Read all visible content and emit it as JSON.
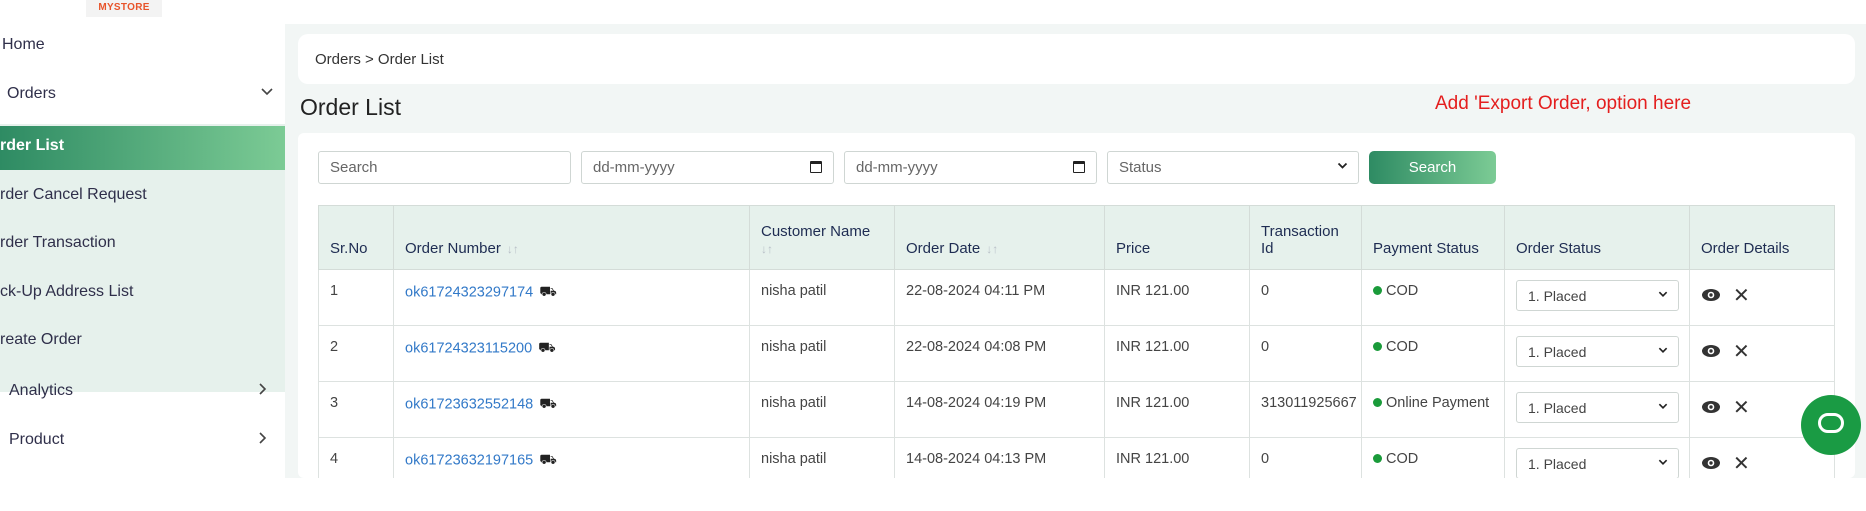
{
  "app": {
    "logo_text": "MYSTORE"
  },
  "sidebar": {
    "home": "Home",
    "orders": "Orders",
    "order_list": "rder List",
    "order_cancel_request": "rder Cancel Request",
    "order_transaction": "rder Transaction",
    "pickup_address_list": "ck-Up Address List",
    "create_order": "reate Order",
    "analytics": "Analytics",
    "product": "Product"
  },
  "breadcrumb": "Orders > Order List",
  "page_title": "Order List",
  "note": "Add 'Export Order, option here",
  "filters": {
    "search_placeholder": "Search",
    "date_from_placeholder": "dd-mm-yyyy",
    "date_to_placeholder": "dd-mm-yyyy",
    "status_selected": "Status",
    "search_button": "Search"
  },
  "table": {
    "headers": {
      "sr_no": "Sr.No",
      "order_number": "Order Number",
      "customer_name": "Customer Name",
      "order_date": "Order Date",
      "price": "Price",
      "transaction_id": "Transaction Id",
      "payment_status": "Payment Status",
      "order_status": "Order Status",
      "order_details": "Order Details"
    },
    "rows": [
      {
        "sr": "1",
        "order_number": "ok61724323297174",
        "customer": "nisha patil",
        "date": "22-08-2024 04:11 PM",
        "price": "INR 121.00",
        "txn": "0",
        "payment": "COD",
        "status": "1. Placed"
      },
      {
        "sr": "2",
        "order_number": "ok61724323115200",
        "customer": "nisha patil",
        "date": "22-08-2024 04:08 PM",
        "price": "INR 121.00",
        "txn": "0",
        "payment": "COD",
        "status": "1. Placed"
      },
      {
        "sr": "3",
        "order_number": "ok61723632552148",
        "customer": "nisha patil",
        "date": "14-08-2024 04:19 PM",
        "price": "INR 121.00",
        "txn": "313011925667",
        "payment": "Online Payment",
        "status": "1. Placed"
      },
      {
        "sr": "4",
        "order_number": "ok61723632197165",
        "customer": "nisha patil",
        "date": "14-08-2024 04:13 PM",
        "price": "INR 121.00",
        "txn": "0",
        "payment": "COD",
        "status": "1. Placed"
      }
    ]
  },
  "colors": {
    "accent": "#2e8b63",
    "accent_light": "#7ccb95",
    "note": "#e41e1e",
    "link": "#3279c8",
    "status_dot": "#1a9b3a"
  }
}
